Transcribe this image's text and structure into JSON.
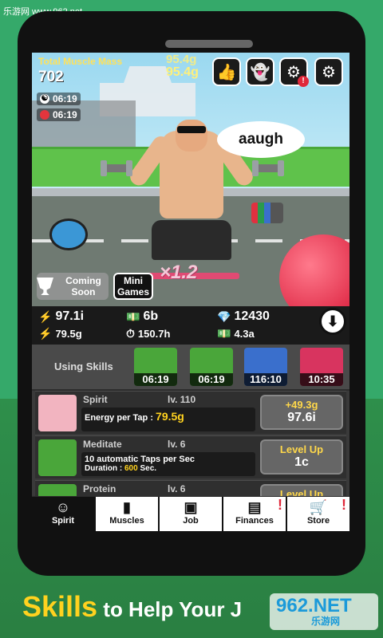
{
  "watermark_top": "乐游网 www.962.net",
  "hud": {
    "total_label": "Total Muscle Mass",
    "total_value": "702",
    "rate_top": "95.4g",
    "rate_main": "95.4g",
    "timers": [
      "06:19",
      "06:19"
    ]
  },
  "speech": "aaugh",
  "multiplier": "×1.2",
  "scene_buttons": {
    "coming_soon": "Coming Soon",
    "mini_games": "Mini Games"
  },
  "resources": {
    "strength": "97.1i",
    "cash": "6b",
    "gems": "12430",
    "strength_rate": "79.5g",
    "time_left": "150.7h",
    "cash_rate": "4.3a"
  },
  "skills_strip": {
    "label": "Using Skills",
    "slots": [
      {
        "timer": "06:19",
        "color": "#4aa63a"
      },
      {
        "timer": "06:19",
        "color": "#4aa63a"
      },
      {
        "timer": "116:10",
        "color": "#3a6fcc"
      },
      {
        "timer": "10:35",
        "color": "#d8345f"
      }
    ]
  },
  "rows": [
    {
      "title": "Spirit",
      "lv": "lv. 110",
      "desc1": "Energy per Tap :",
      "desc1_val": "79.5g",
      "desc2": "",
      "btn_top": "+49.3g",
      "btn_bottom": "97.6i"
    },
    {
      "title": "Meditate",
      "lv": "lv. 6",
      "desc1": "10 automatic Taps per Sec",
      "desc2_label": "Duration :",
      "desc2_val": "600",
      "desc2_unit": "Sec.",
      "btn_top": "Level Up",
      "btn_bottom": "1c"
    },
    {
      "title": "Protein",
      "lv": "lv. 6",
      "btn_top": "Level Up"
    }
  ],
  "nav": [
    {
      "label": "Spirit",
      "active": true
    },
    {
      "label": "Muscles"
    },
    {
      "label": "Job"
    },
    {
      "label": "Finances",
      "alert": "!"
    },
    {
      "label": "Store",
      "alert": "!"
    }
  ],
  "caption": {
    "highlight": "Skills",
    "rest": " to Help Your J"
  },
  "watermark_bottom": {
    "num": "962.NET",
    "sub": "乐游网"
  },
  "colors": {
    "accent_yellow": "#ffd21f",
    "bg_green": "#2f9e5a",
    "alert_red": "#e0283a"
  }
}
